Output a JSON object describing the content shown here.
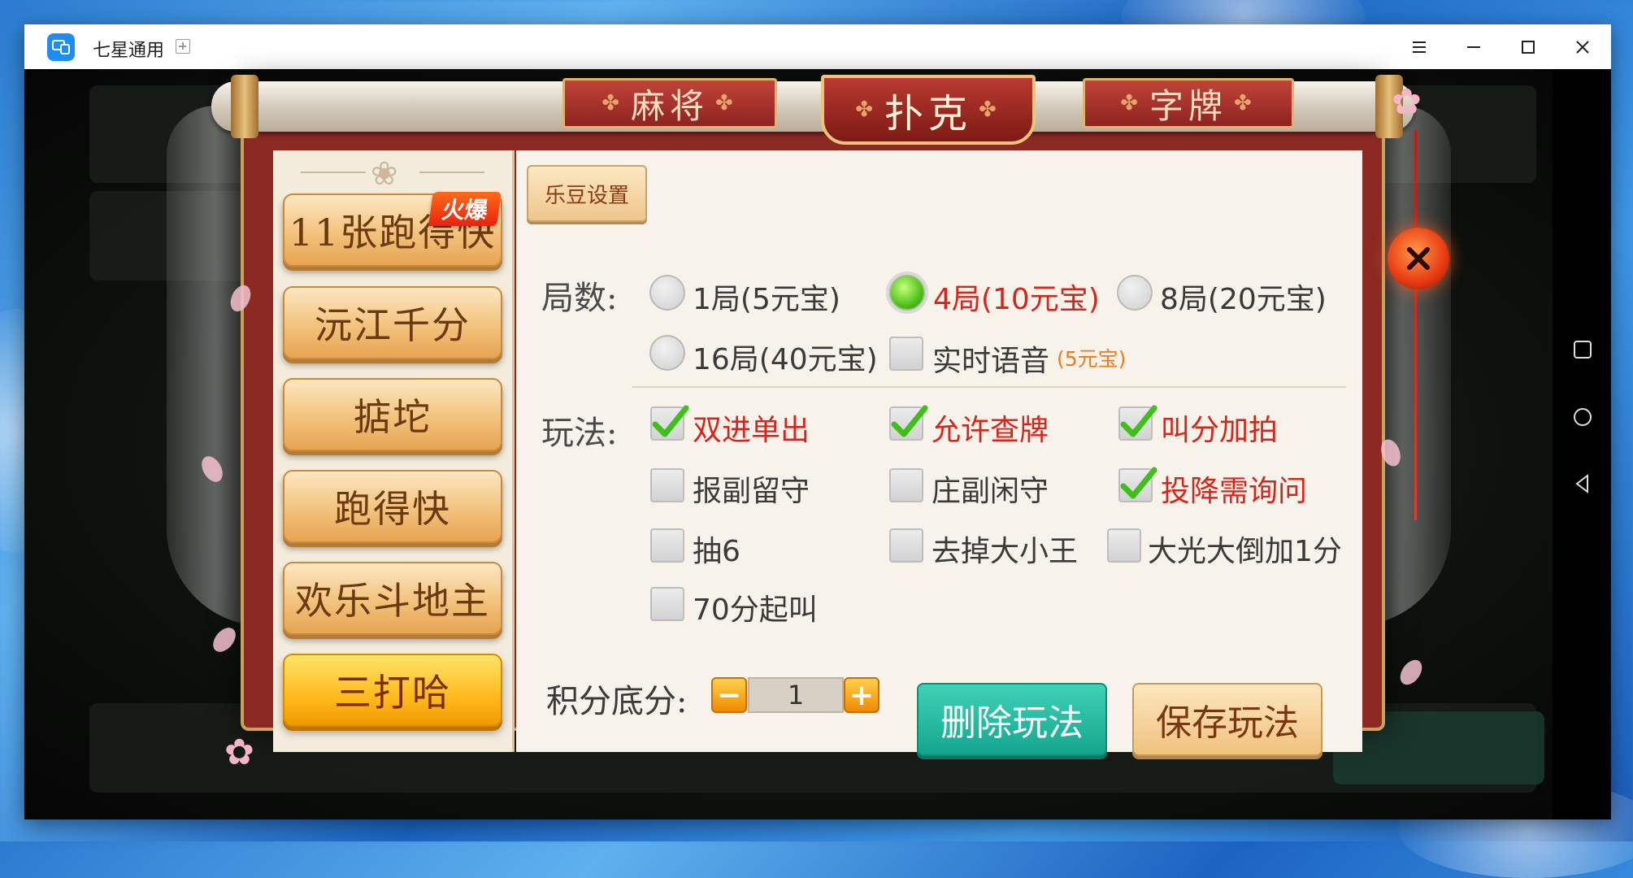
{
  "window": {
    "title": "七星通用"
  },
  "tabs": [
    {
      "label": "麻将"
    },
    {
      "label": "扑克"
    },
    {
      "label": "字牌"
    }
  ],
  "games": {
    "hot_badge": "火爆",
    "items": [
      {
        "label": "11张跑得快"
      },
      {
        "label": "沅江千分"
      },
      {
        "label": "掂坨"
      },
      {
        "label": "跑得快"
      },
      {
        "label": "欢乐斗地主"
      },
      {
        "label": "三打哈"
      }
    ],
    "selected": "三打哈"
  },
  "ledou_settings": "乐豆设置",
  "rounds": {
    "label": "局数:",
    "options": [
      {
        "label": "1局(5元宝)",
        "selected": false
      },
      {
        "label": "4局(10元宝)",
        "selected": true
      },
      {
        "label": "8局(20元宝)",
        "selected": false
      },
      {
        "label": "16局(40元宝)",
        "selected": false
      }
    ],
    "voice": {
      "label": "实时语音",
      "cost": "(5元宝)",
      "checked": false
    }
  },
  "rules": {
    "label": "玩法:",
    "options": [
      {
        "label": "双进单出",
        "checked": true
      },
      {
        "label": "允许查牌",
        "checked": true
      },
      {
        "label": "叫分加拍",
        "checked": true
      },
      {
        "label": "报副留守",
        "checked": false
      },
      {
        "label": "庄副闲守",
        "checked": false
      },
      {
        "label": "投降需询问",
        "checked": true
      },
      {
        "label": "抽6",
        "checked": false
      },
      {
        "label": "去掉大小王",
        "checked": false
      },
      {
        "label": "大光大倒加1分",
        "checked": false
      },
      {
        "label": "70分起叫",
        "checked": false
      }
    ]
  },
  "base_score": {
    "label": "积分底分:",
    "minus": "−",
    "plus": "+",
    "value": "1"
  },
  "actions": {
    "delete": "删除玩法",
    "save": "保存玩法"
  },
  "colors": {
    "accent_red": "#d8241b",
    "check_green": "#3fbf1a",
    "delete_teal": "#14a58e",
    "selected_gold": "#ffb91c"
  }
}
